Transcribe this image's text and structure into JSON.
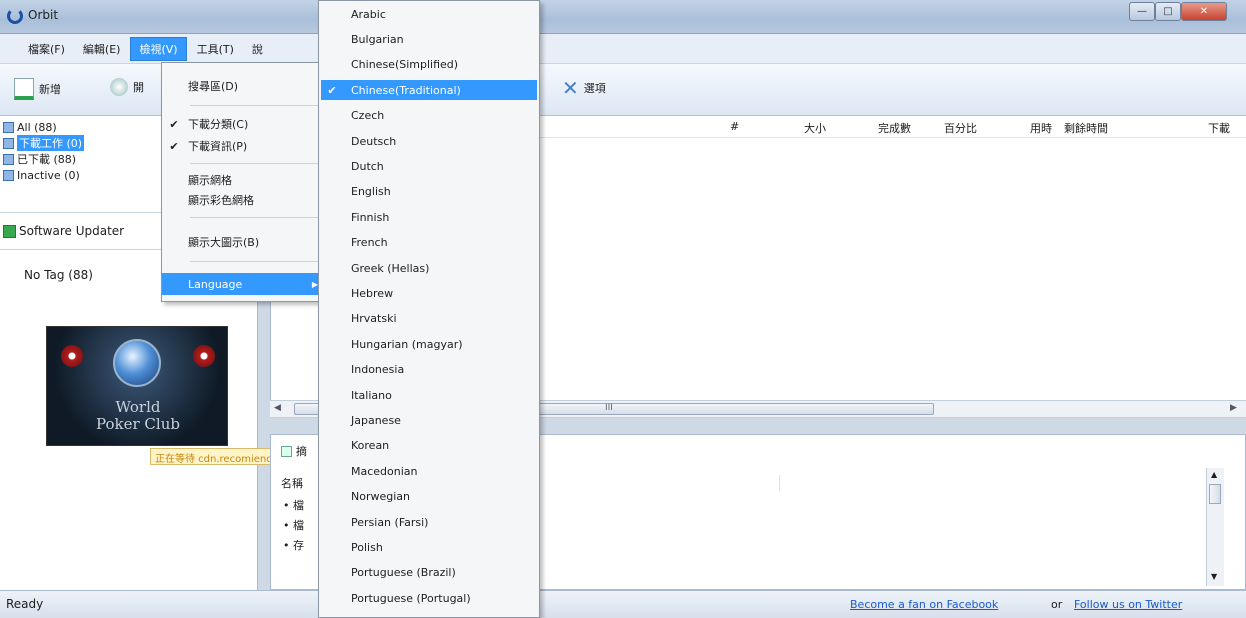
{
  "window": {
    "title": "Orbit",
    "minimize": "—",
    "maximize": "□",
    "close": "✕"
  },
  "menubar": {
    "items": [
      "檔案(F)",
      "編輯(E)",
      "檢視(V)",
      "工具(T)",
      "說"
    ]
  },
  "toolbar": {
    "new_label": "新增",
    "start_label": "開",
    "options_label": "選項"
  },
  "sidebar": {
    "categories": [
      {
        "label": "All (88)"
      },
      {
        "label": "下載工作 (0)"
      },
      {
        "label": "已下載 (88)"
      },
      {
        "label": "Inactive (0)"
      }
    ],
    "software_updater": "Software Updater",
    "no_tag": "No Tag (88)"
  },
  "ad": {
    "title_line1": "World",
    "title_line2": "Poker Club",
    "tooltip": "正在等待 cdn.recomiende"
  },
  "list": {
    "columns": [
      "#",
      "大小",
      "完成數",
      "百分比",
      "用時",
      "剩餘時間",
      "下載"
    ],
    "scroll_mark": "III"
  },
  "details": {
    "tab_label": "摘",
    "name_col": "名稱",
    "rows": [
      "• 檔",
      "• 檔",
      "• 存"
    ]
  },
  "statusbar": {
    "status": "Ready",
    "facebook": "Become a fan on Facebook",
    "or": "or",
    "twitter": "Follow us on Twitter"
  },
  "view_menu": {
    "items": [
      {
        "label": "搜尋區(D)",
        "checked": false
      },
      {
        "label": "下載分類(C)",
        "checked": true
      },
      {
        "label": "下載資訊(P)",
        "checked": true
      },
      {
        "label": "顯示網格",
        "checked": false
      },
      {
        "label": "顯示彩色網格",
        "checked": false
      },
      {
        "label": "顯示大圖示(B)",
        "checked": false
      },
      {
        "label": "Language",
        "checked": false
      }
    ]
  },
  "language_menu": {
    "selected": "Chinese(Traditional)",
    "items": [
      "Arabic",
      "Bulgarian",
      "Chinese(Simplified)",
      "Chinese(Traditional)",
      "Czech",
      "Deutsch",
      "Dutch",
      "English",
      "Finnish",
      "French",
      "Greek (Hellas)",
      "Hebrew",
      "Hrvatski",
      "Hungarian (magyar)",
      "Indonesia",
      "Italiano",
      "Japanese",
      "Korean",
      "Macedonian",
      "Norwegian",
      "Persian (Farsi)",
      "Polish",
      "Portuguese (Brazil)",
      "Portuguese (Portugal)"
    ]
  },
  "colors": {
    "accent": "#3399ff",
    "link": "#1a5ac8"
  }
}
